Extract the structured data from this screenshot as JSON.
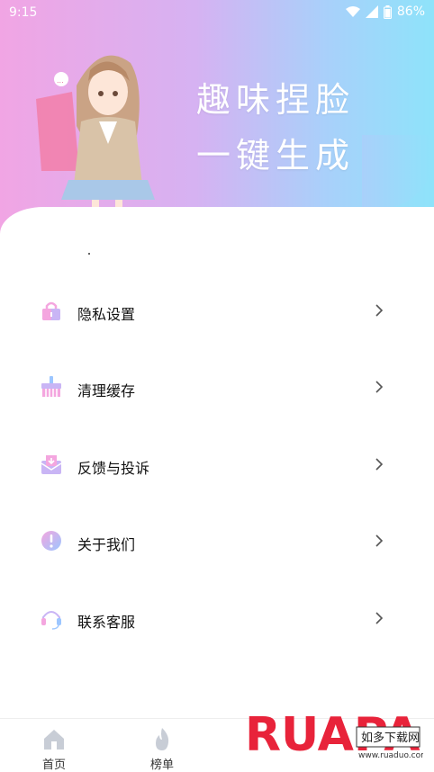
{
  "status": {
    "time": "9:15",
    "battery": "86%"
  },
  "header": {
    "slogan_line1": "趣味捏脸",
    "slogan_line2": "一键生成"
  },
  "menu": [
    {
      "label": "隐私设置",
      "icon": "lock-icon"
    },
    {
      "label": "清理缓存",
      "icon": "broom-icon"
    },
    {
      "label": "反馈与投诉",
      "icon": "mail-icon"
    },
    {
      "label": "关于我们",
      "icon": "info-icon"
    },
    {
      "label": "联系客服",
      "icon": "headset-icon"
    }
  ],
  "bottom_nav": [
    {
      "label": "首页",
      "icon": "home-icon"
    },
    {
      "label": "榜单",
      "icon": "flame-icon"
    }
  ],
  "watermark": {
    "brand": "RUAPADO",
    "sub": "如多下载网",
    "url": "www.ruaduo.com"
  },
  "colors": {
    "gradient_left": "#f1a5e4",
    "gradient_right": "#8ee3fa",
    "icon_pink": "#f4a6df",
    "icon_blue": "#9cc6ff"
  }
}
